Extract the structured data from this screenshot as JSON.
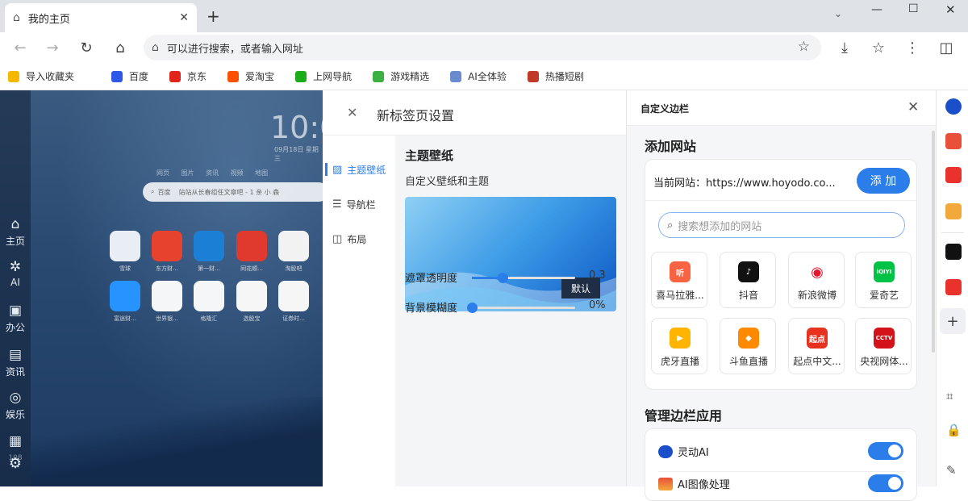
{
  "browser": {
    "tab_title": "我的主页",
    "omnibox_placeholder": "可以进行搜索，或者输入网址"
  },
  "bookmarks": [
    {
      "label": "导入收藏夹",
      "color": "#f5b800"
    },
    {
      "label": "百度",
      "color": "#2e58e6"
    },
    {
      "label": "京东",
      "color": "#e1251b"
    },
    {
      "label": "爱淘宝",
      "color": "#ff5000"
    },
    {
      "label": "上网导航",
      "color": "#1aad19"
    },
    {
      "label": "游戏精选",
      "color": "#3cb043"
    },
    {
      "label": "AI全体验",
      "color": "#6a8ccf"
    },
    {
      "label": "热播短剧",
      "color": "#c0392b"
    }
  ],
  "ntp": {
    "clock": "10:0",
    "date": "09月18日 星期三",
    "search_tabs": "网页 图片 资讯 视频 地图",
    "search_engine": "百度",
    "search_placeholder": "站站从长春组任文章吧 - 1 亲 小 森",
    "left_rail": [
      "主页",
      "AI",
      "办公",
      "资讯",
      "娱乐",
      "108"
    ],
    "apps": [
      {
        "label": "雪球",
        "color": "#e9eef4"
      },
      {
        "label": "东方财...",
        "color": "#e6422e"
      },
      {
        "label": "第一财...",
        "color": "#1c7fd6"
      },
      {
        "label": "同花顺...",
        "color": "#e03a2f"
      },
      {
        "label": "淘股吧",
        "color": "#f2f2f2"
      },
      {
        "label": "富途财...",
        "color": "#2693ff"
      },
      {
        "label": "世界银...",
        "color": "#f4f6f8"
      },
      {
        "label": "格隆汇",
        "color": "#f4f6f8"
      },
      {
        "label": "选股宝",
        "color": "#f6f6f6"
      },
      {
        "label": "证券时...",
        "color": "#f6f6f6"
      }
    ]
  },
  "settings": {
    "title": "新标签页设置",
    "nav": [
      "主题壁纸",
      "导航栏",
      "布局"
    ],
    "section_title": "主题壁纸",
    "section_subtitle": "自定义壁纸和主题",
    "wallpaper_badge": "默认",
    "sliders": [
      {
        "label": "遮罩透明度",
        "value_text": "0.3",
        "fraction": 0.3
      },
      {
        "label": "背景模糊度",
        "value_text": "0%",
        "fraction": 0
      }
    ]
  },
  "sidebar_panel": {
    "title": "自定义边栏",
    "add_section": "添加网站",
    "current_site_label": "当前网站：",
    "current_site_url": "https://www.hoyodo.co...",
    "add_button": "添 加",
    "search_placeholder": "搜索想添加的网站",
    "sites": [
      {
        "label": "喜马拉雅...",
        "color": "#f86442",
        "glyph": "听"
      },
      {
        "label": "抖音",
        "color": "#111111",
        "glyph": "♪"
      },
      {
        "label": "新浪微博",
        "color": "#ffffff",
        "glyph": "◉"
      },
      {
        "label": "爱奇艺",
        "color": "#00c244",
        "glyph": "iQIYI"
      },
      {
        "label": "虎牙直播",
        "color": "#ffb400",
        "glyph": "▶"
      },
      {
        "label": "斗鱼直播",
        "color": "#ff8a00",
        "glyph": "◆"
      },
      {
        "label": "起点中文...",
        "color": "#e7321f",
        "glyph": "起点"
      },
      {
        "label": "央视网体...",
        "color": "#d3121a",
        "glyph": "CCTV"
      }
    ],
    "manage_section": "管理边栏应用",
    "apps": [
      {
        "label": "灵动AI",
        "enabled": true
      },
      {
        "label": "AI图像处理",
        "enabled": true
      }
    ]
  },
  "right_rail_colors": [
    "#1a4fc9",
    "#e8503a",
    "#e8322b",
    "#f2a93b",
    "#111111",
    "#e8322b"
  ]
}
